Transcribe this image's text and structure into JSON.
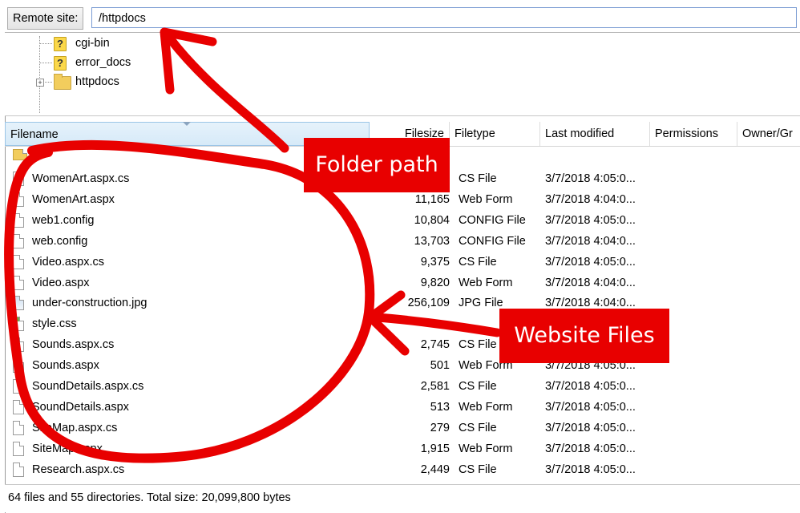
{
  "remote_site": {
    "label": "Remote site:",
    "path": "/httpdocs"
  },
  "tree": {
    "items": [
      {
        "label": "cgi-bin",
        "icon": "question-folder-icon"
      },
      {
        "label": "error_docs",
        "icon": "question-folder-icon"
      },
      {
        "label": "httpdocs",
        "icon": "folder-icon",
        "expandable": true
      }
    ]
  },
  "columns": [
    "Filename",
    "Filesize",
    "Filetype",
    "Last modified",
    "Permissions",
    "Owner/Gr"
  ],
  "parent_dir": "..",
  "files": [
    {
      "name": "WomenArt.aspx.cs",
      "size": "",
      "type": "CS File",
      "modified": "3/7/2018 4:05:0..."
    },
    {
      "name": "WomenArt.aspx",
      "size": "11,165",
      "type": "Web Form",
      "modified": "3/7/2018 4:04:0..."
    },
    {
      "name": "web1.config",
      "size": "10,804",
      "type": "CONFIG File",
      "modified": "3/7/2018 4:05:0..."
    },
    {
      "name": "web.config",
      "size": "13,703",
      "type": "CONFIG File",
      "modified": "3/7/2018 4:04:0..."
    },
    {
      "name": "Video.aspx.cs",
      "size": "9,375",
      "type": "CS File",
      "modified": "3/7/2018 4:05:0..."
    },
    {
      "name": "Video.aspx",
      "size": "9,820",
      "type": "Web Form",
      "modified": "3/7/2018 4:04:0..."
    },
    {
      "name": "under-construction.jpg",
      "size": "256,109",
      "type": "JPG File",
      "modified": "3/7/2018 4:04:0..."
    },
    {
      "name": "style.css",
      "size": "",
      "type": "",
      "modified": ""
    },
    {
      "name": "Sounds.aspx.cs",
      "size": "2,745",
      "type": "CS File",
      "modified": ""
    },
    {
      "name": "Sounds.aspx",
      "size": "501",
      "type": "Web Form",
      "modified": "3/7/2018 4:05:0..."
    },
    {
      "name": "SoundDetails.aspx.cs",
      "size": "2,581",
      "type": "CS File",
      "modified": "3/7/2018 4:05:0..."
    },
    {
      "name": "SoundDetails.aspx",
      "size": "513",
      "type": "Web Form",
      "modified": "3/7/2018 4:05:0..."
    },
    {
      "name": "SiteMap.aspx.cs",
      "size": "279",
      "type": "CS File",
      "modified": "3/7/2018 4:05:0..."
    },
    {
      "name": "SiteMap.aspx",
      "size": "1,915",
      "type": "Web Form",
      "modified": "3/7/2018 4:05:0..."
    },
    {
      "name": "Research.aspx.cs",
      "size": "2,449",
      "type": "CS File",
      "modified": "3/7/2018 4:05:0..."
    }
  ],
  "status": "64 files and 55 directories. Total size: 20,099,800 bytes",
  "annotations": {
    "folder_path": "Folder path",
    "website_files": "Website Files",
    "color": "#e80000"
  }
}
